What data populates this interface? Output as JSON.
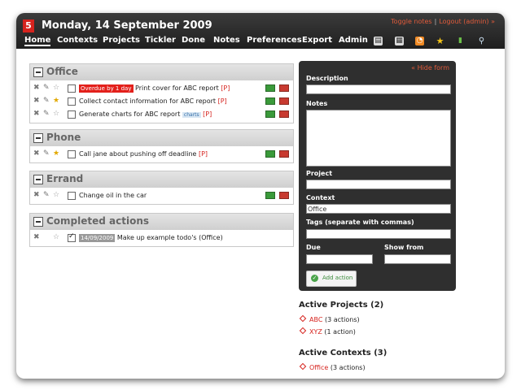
{
  "header": {
    "date_title": "Monday, 14 September 2009",
    "calendar_day": "5",
    "toggle_notes": "Toggle notes",
    "logout": "Logout (admin) »",
    "separator": "|"
  },
  "nav": {
    "items": [
      "Home",
      "Contexts",
      "Projects",
      "Tickler",
      "Done",
      "Notes",
      "Preferences",
      "Export",
      "Admin"
    ],
    "active": "Home",
    "icons": [
      "print-icon",
      "calendar-icon",
      "rss-icon",
      "star-icon",
      "stats-icon",
      "search-icon"
    ]
  },
  "contexts": [
    {
      "title": "Office",
      "actions": [
        {
          "badge": "Overdue by 1 day",
          "text": "Print cover for ABC report",
          "project_link": "[P]",
          "starred": false
        },
        {
          "text": "Collect contact information for ABC report",
          "project_link": "[P]",
          "starred": true
        },
        {
          "text": "Generate charts for ABC report",
          "tag": "charts",
          "project_link": "[P]",
          "starred": false
        }
      ]
    },
    {
      "title": "Phone",
      "actions": [
        {
          "text": "Call jane about pushing off deadline",
          "project_link": "[P]",
          "starred": true
        }
      ]
    },
    {
      "title": "Errand",
      "actions": [
        {
          "text": "Change oil in the car",
          "starred": false
        }
      ]
    }
  ],
  "completed": {
    "title": "Completed actions",
    "actions": [
      {
        "date": "14/09/2009",
        "text": "Make up example todo's (Office)"
      }
    ]
  },
  "form": {
    "hide_link": "« Hide form",
    "description_label": "Description",
    "description_value": "",
    "notes_label": "Notes",
    "notes_value": "",
    "project_label": "Project",
    "project_value": "",
    "context_label": "Context",
    "context_value": "Office",
    "tags_label": "Tags (separate with commas)",
    "tags_value": "",
    "due_label": "Due",
    "due_value": "",
    "show_from_label": "Show from",
    "show_from_value": "",
    "add_button": "Add action"
  },
  "active_projects": {
    "title": "Active Projects (2)",
    "items": [
      {
        "name": "ABC",
        "count": "(3 actions)"
      },
      {
        "name": "XYZ",
        "count": "(1 action)"
      }
    ]
  },
  "active_contexts": {
    "title": "Active Contexts (3)",
    "items": [
      {
        "name": "Office",
        "count": "(3 actions)"
      }
    ]
  },
  "colors": {
    "accent_red": "#d6231e",
    "header_bg": "#2a2a2a",
    "link_orange": "#e05a3a"
  }
}
